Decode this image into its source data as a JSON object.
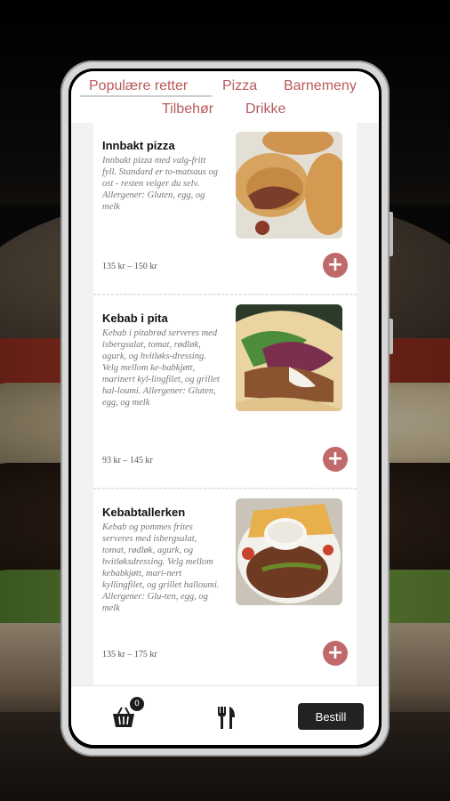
{
  "tabs": [
    {
      "label": "Populære retter",
      "active": true
    },
    {
      "label": "Pizza",
      "active": false
    },
    {
      "label": "Barnemeny",
      "active": false
    },
    {
      "label": "Tilbehør",
      "active": false
    },
    {
      "label": "Drikke",
      "active": false
    }
  ],
  "menu_items": [
    {
      "name": "Innbakt pizza",
      "description": "Innbakt pizza med valg-fritt fyll. Standard er to-matsaus og ost - resten velger du selv. Allergener: Gluten, egg, og melk",
      "price": "135 kr – 150 kr",
      "image": "calzone-photo"
    },
    {
      "name": "Kebab i pita",
      "description": "Kebab i pitabrød serveres med isbergsalat, tomat, rødløk, agurk, og hvitløks-dressing. Velg mellom ke-babkjøtt, marinert kyl-lingfilet, og grillet hal-loumi. Allergener: Gluten, egg, og melk",
      "price": "93 kr – 145 kr",
      "image": "kebab-pita-photo"
    },
    {
      "name": "Kebabtallerken",
      "description": "Kebab og pommes frites serveres med isbergsalat, tomat, rødløk, agurk, og hvitløksdressing. Velg mellom kebabkjøtt, mari-nert kyllingfilet, og grillet halloumi. Allergener: Glu-ten, egg, og melk",
      "price": "135 kr – 175 kr",
      "image": "kebab-plate-photo"
    }
  ],
  "add_icon": "plus-circle-icon",
  "bottom_bar": {
    "cart_icon": "basket-icon",
    "cart_count": "0",
    "menu_icon": "fork-knife-icon",
    "order_label": "Bestill"
  },
  "colors": {
    "accent": "#c0696a",
    "tab_text": "#b85a5a",
    "order_button": "#222222"
  }
}
